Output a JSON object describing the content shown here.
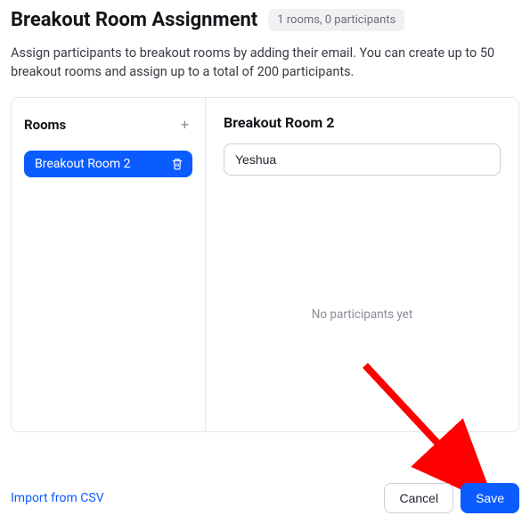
{
  "header": {
    "title": "Breakout Room Assignment",
    "badge": "1 rooms, 0 participants"
  },
  "description": "Assign participants to breakout rooms by adding their email. You can create up to 50 breakout rooms and assign up to a total of 200 participants.",
  "sidebar": {
    "title": "Rooms",
    "rooms": [
      {
        "label": "Breakout Room 2"
      }
    ]
  },
  "detail": {
    "title": "Breakout Room 2",
    "input_value": "Yeshua",
    "empty_text": "No participants yet"
  },
  "footer": {
    "import_label": "Import from CSV",
    "cancel_label": "Cancel",
    "save_label": "Save"
  }
}
